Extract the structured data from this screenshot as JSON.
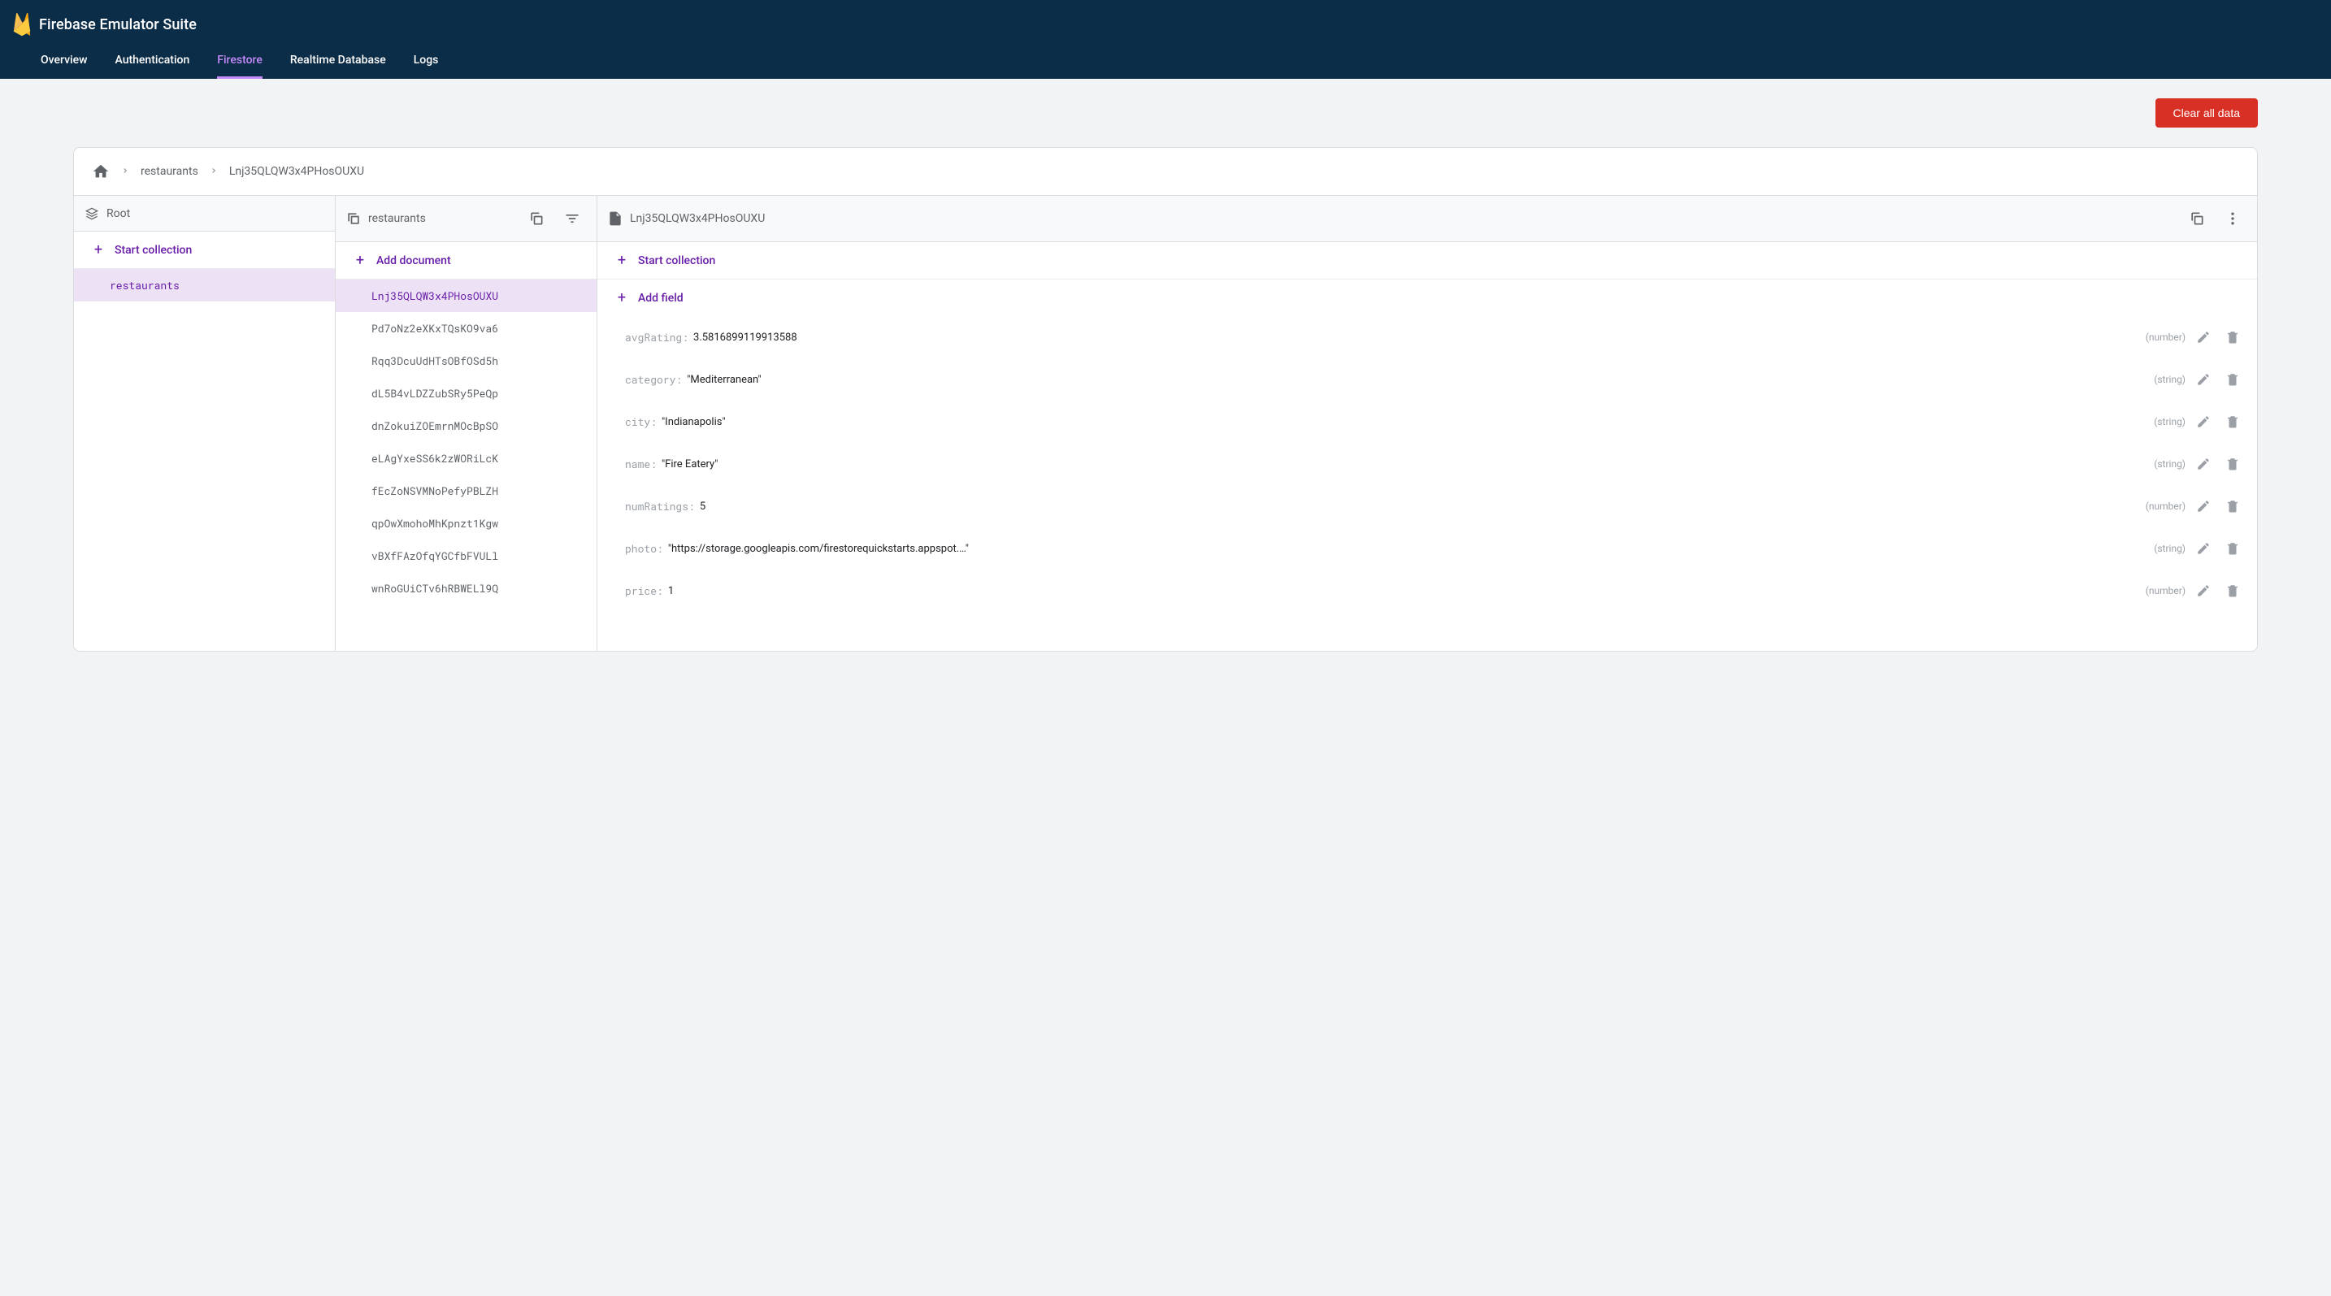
{
  "header": {
    "title": "Firebase Emulator Suite",
    "tabs": [
      {
        "label": "Overview",
        "active": false
      },
      {
        "label": "Authentication",
        "active": false
      },
      {
        "label": "Firestore",
        "active": true
      },
      {
        "label": "Realtime Database",
        "active": false
      },
      {
        "label": "Logs",
        "active": false
      }
    ]
  },
  "toolbar": {
    "clear_data_label": "Clear all data"
  },
  "breadcrumb": {
    "items": [
      "restaurants",
      "Lnj35QLQW3x4PHosOUXU"
    ]
  },
  "col1": {
    "title": "Root",
    "action": "Start collection",
    "items": [
      {
        "id": "restaurants",
        "selected": true
      }
    ]
  },
  "col2": {
    "title": "restaurants",
    "action": "Add document",
    "items": [
      {
        "id": "Lnj35QLQW3x4PHosOUXU",
        "selected": true
      },
      {
        "id": "Pd7oNz2eXKxTQsKO9va6",
        "selected": false
      },
      {
        "id": "Rqq3DcuUdHTsOBfOSd5h",
        "selected": false
      },
      {
        "id": "dL5B4vLDZZubSRy5PeQp",
        "selected": false
      },
      {
        "id": "dnZokuiZOEmrnMOcBpSO",
        "selected": false
      },
      {
        "id": "eLAgYxeSS6k2zWORiLcK",
        "selected": false
      },
      {
        "id": "fEcZoNSVMNoPefyPBLZH",
        "selected": false
      },
      {
        "id": "qpOwXmohoMhKpnzt1Kgw",
        "selected": false
      },
      {
        "id": "vBXfFAzOfqYGCfbFVULl",
        "selected": false
      },
      {
        "id": "wnRoGUiCTv6hRBWELl9Q",
        "selected": false
      }
    ]
  },
  "col3": {
    "title": "Lnj35QLQW3x4PHosOUXU",
    "action_start": "Start collection",
    "action_add": "Add field",
    "fields": [
      {
        "key": "avgRating",
        "value": "3.5816899119913588",
        "type": "number",
        "quoted": false
      },
      {
        "key": "category",
        "value": "Mediterranean",
        "type": "string",
        "quoted": true
      },
      {
        "key": "city",
        "value": "Indianapolis",
        "type": "string",
        "quoted": true
      },
      {
        "key": "name",
        "value": "Fire Eatery",
        "type": "string",
        "quoted": true
      },
      {
        "key": "numRatings",
        "value": "5",
        "type": "number",
        "quoted": false
      },
      {
        "key": "photo",
        "value": "https://storage.googleapis.com/firestorequickstarts.appspot.…",
        "type": "string",
        "quoted": true
      },
      {
        "key": "price",
        "value": "1",
        "type": "number",
        "quoted": false
      }
    ]
  }
}
